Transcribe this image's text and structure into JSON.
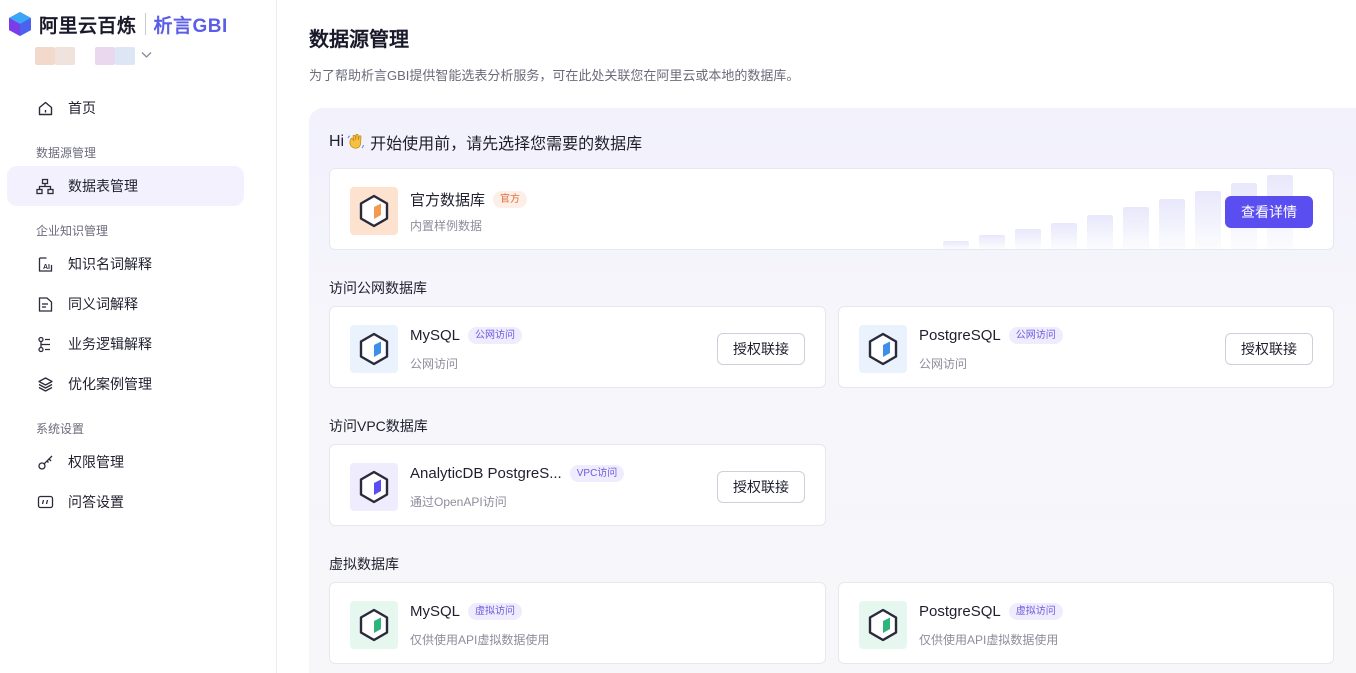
{
  "brand": {
    "name": "阿里云百炼",
    "product": "析言GBI"
  },
  "user": {
    "dropdown_icon": "chevron-down-icon"
  },
  "sidebar": {
    "home": {
      "label": "首页",
      "icon": "home-icon"
    },
    "groups": [
      {
        "title": "数据源管理",
        "items": [
          {
            "label": "数据表管理",
            "icon": "sitemap-icon",
            "active": true
          }
        ]
      },
      {
        "title": "企业知识管理",
        "items": [
          {
            "label": "知识名词解释",
            "icon": "ai-doc-icon"
          },
          {
            "label": "同义词解释",
            "icon": "doc-lines-icon"
          },
          {
            "label": "业务逻辑解释",
            "icon": "flow-icon"
          },
          {
            "label": "优化案例管理",
            "icon": "layers-icon"
          }
        ]
      },
      {
        "title": "系统设置",
        "items": [
          {
            "label": "权限管理",
            "icon": "key-icon"
          },
          {
            "label": "问答设置",
            "icon": "chat-settings-icon"
          }
        ]
      }
    ]
  },
  "main": {
    "title": "数据源管理",
    "description": "为了帮助析言GBI提供智能选表分析服务，可在此处关联您在阿里云或本地的数据库。",
    "greeting_hi": "Hi",
    "greeting_text": "开始使用前，请先选择您需要的数据库",
    "official": {
      "name": "官方数据库",
      "tag": "官方",
      "sub": "内置样例数据",
      "button": "查看详情"
    },
    "public_section": "访问公网数据库",
    "public_dbs": [
      {
        "name": "MySQL",
        "tag": "公网访问",
        "sub": "公网访问",
        "button": "授权联接"
      },
      {
        "name": "PostgreSQL",
        "tag": "公网访问",
        "sub": "公网访问",
        "button": "授权联接"
      }
    ],
    "vpc_section": "访问VPC数据库",
    "vpc_dbs": [
      {
        "name": "AnalyticDB PostgreS...",
        "tag": "VPC访问",
        "sub": "通过OpenAPI访问",
        "button": "授权联接"
      }
    ],
    "virtual_section": "虚拟数据库",
    "virtual_dbs": [
      {
        "name": "MySQL",
        "tag": "虚拟访问",
        "sub": "仅供使用API虚拟数据使用"
      },
      {
        "name": "PostgreSQL",
        "tag": "虚拟访问",
        "sub": "仅供使用API虚拟数据使用"
      }
    ]
  },
  "colors": {
    "accent": "#5b4ef0",
    "active_bg": "#f2f1fd",
    "official_tag": "#e0703c",
    "cube_orange": "#f29a52",
    "cube_blue": "#3d8fe8",
    "cube_purple": "#5b4ef0",
    "cube_green": "#2fb47c"
  }
}
